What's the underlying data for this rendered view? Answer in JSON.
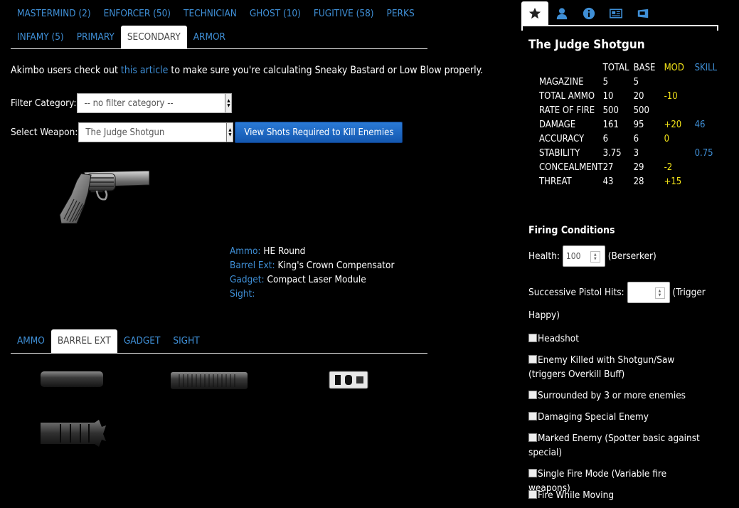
{
  "class_tabs_row1": [
    "MASTERMIND (2)",
    "ENFORCER (50)",
    "TECHNICIAN",
    "GHOST (10)",
    "FUGITIVE (58)",
    "PERKS"
  ],
  "class_tabs_row2": [
    "INFAMY (5)",
    "PRIMARY",
    "SECONDARY",
    "ARMOR"
  ],
  "note": {
    "before": "Akimbo users check out ",
    "link": "this article",
    "after": " to make sure you're calculating Sneaky Bastard or Low Blow properly."
  },
  "filter": {
    "label": "Filter Category:",
    "value": "-- no filter category --"
  },
  "weapon_select": {
    "label": "Select Weapon:",
    "value": "The Judge Shotgun",
    "button": "View Shots Required to Kill Enemies"
  },
  "mods": {
    "ammo_label": "Ammo:",
    "ammo": "HE Round",
    "barrel_label": "Barrel Ext:",
    "barrel": "King's Crown Compensator",
    "gadget_label": "Gadget:",
    "gadget": "Compact Laser Module",
    "sight_label": "Sight:",
    "sight": ""
  },
  "mod_tabs": [
    "AMMO",
    "BARREL EXT",
    "GADGET",
    "SIGHT"
  ],
  "attachment_icons": [
    "suppressor-icon",
    "long-suppressor-icon",
    "compensator-icon",
    "kings-crown-compensator-icon"
  ],
  "panel": {
    "icons": [
      "star-icon",
      "user-icon",
      "info-icon",
      "newspaper-icon",
      "ticket-icon"
    ],
    "weapon_title": "The Judge Shotgun",
    "headers": [
      "",
      "TOTAL",
      "BASE",
      "MOD",
      "SKILL"
    ],
    "stats": [
      [
        "MAGAZINE",
        "5",
        "5",
        "",
        ""
      ],
      [
        "TOTAL AMMO",
        "10",
        "20",
        "-10",
        ""
      ],
      [
        "RATE OF FIRE",
        "500",
        "500",
        "",
        ""
      ],
      [
        "DAMAGE",
        "161",
        "95",
        "+20",
        "46"
      ],
      [
        "ACCURACY",
        "6",
        "6",
        "0",
        ""
      ],
      [
        "STABILITY",
        "3.75",
        "3",
        "",
        "0.75"
      ],
      [
        "CONCEALMENT",
        "27",
        "29",
        "-2",
        ""
      ],
      [
        "THREAT",
        "43",
        "28",
        "+15",
        ""
      ]
    ],
    "firing_title": "Firing Conditions",
    "health_label": "Health:",
    "health_value": "100",
    "health_suffix": "(Berserker)",
    "pistol_label": "Successive Pistol Hits:",
    "pistol_value": "",
    "pistol_suffix": "(Trigger Happy)",
    "conditions": [
      "Headshot",
      "Enemy Killed with Shotgun/Saw (triggers Overkill Buff)",
      "Surrounded by 3 or more enemies",
      "Damaging Special Enemy",
      "Marked Enemy (Spotter basic against special)",
      "Single Fire Mode (Variable fire weapons)",
      "Fire While Moving"
    ]
  },
  "colors": {
    "link": "#3f8fd6",
    "mod": "#f2e318",
    "skill": "#3f8fd6",
    "button": "#1d66c0"
  }
}
